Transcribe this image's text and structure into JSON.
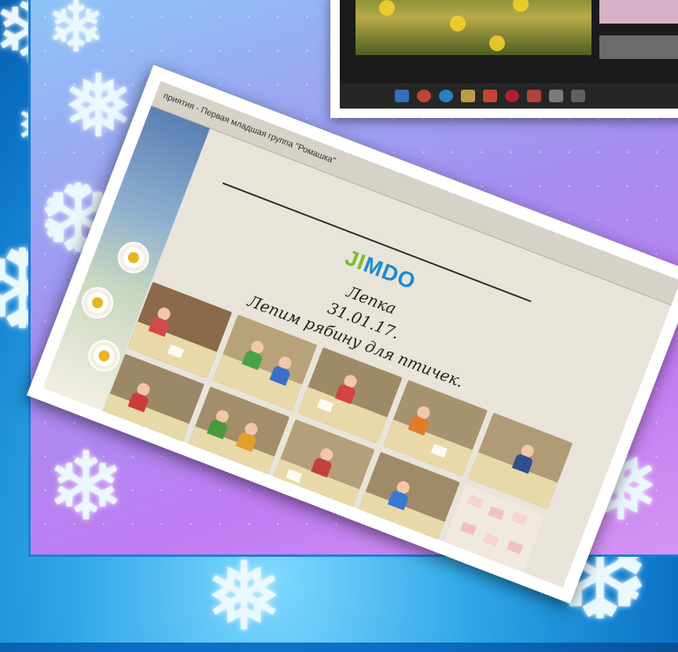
{
  "colors": {
    "frame_blue": "#1a7fd6",
    "panel_gradient": [
      "#8ec4f5",
      "#a48ff0",
      "#c07cf1",
      "#d494f3"
    ],
    "logo_blue": "#1e8ad1",
    "logo_green": "#7cbd2a"
  },
  "icons": {
    "snowflake": "snowflake-icon",
    "daisy": "daisy-icon"
  },
  "main_photo": {
    "tab_title": "приятия - Первая младшая группа \"Ромашка\"",
    "logo": "JIMDO",
    "title": "Лепка",
    "date": "31.01.17.",
    "description": "Лепим рябину для птичек."
  },
  "gallery": {
    "rows": 2,
    "columns": 5,
    "count": 10
  },
  "taskbar": {
    "icons": [
      "windows-icon",
      "chrome-icon",
      "ie-icon",
      "explorer-icon",
      "yandex-icon",
      "opera-icon",
      "app-icon",
      "app-icon",
      "app-icon"
    ]
  }
}
